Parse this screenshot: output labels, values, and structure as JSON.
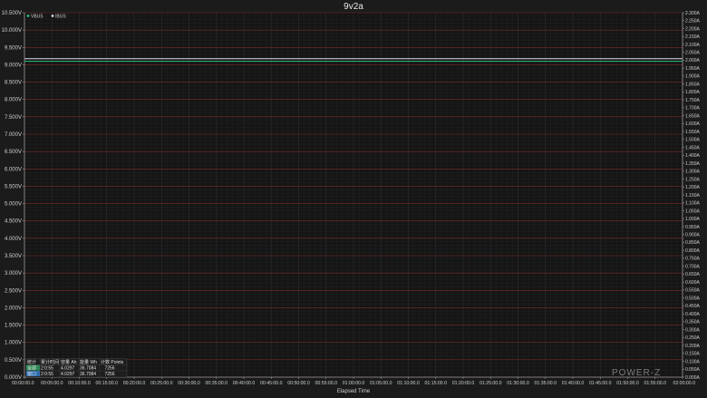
{
  "chart_data": {
    "type": "line",
    "title": "9v2a",
    "xlabel": "Elapsed Time",
    "ylabel_left": "",
    "ylabel_right": "",
    "x_ticks": [
      "00:00:00.0",
      "00:05:00.0",
      "00:10:00.0",
      "00:15:00.0",
      "00:20:00.0",
      "00:25:00.0",
      "00:30:00.0",
      "00:35:00.0",
      "00:40:00.0",
      "00:45:00.0",
      "00:50:00.0",
      "00:55:00.0",
      "01:00:00.0",
      "01:05:00.0",
      "01:10:00.0",
      "01:15:00.0",
      "01:20:00.0",
      "01:25:00.0",
      "01:30:00.0",
      "01:35:00.0",
      "01:40:00.0",
      "01:45:00.0",
      "01:50:00.0",
      "01:55:00.0",
      "02:00:00.0"
    ],
    "xlim_seconds": [
      0,
      7200
    ],
    "ylim_left": [
      0,
      10.5
    ],
    "y_left_ticks": [
      "0.000V",
      "0.500V",
      "1.000V",
      "1.500V",
      "2.000V",
      "2.500V",
      "3.000V",
      "3.500V",
      "4.000V",
      "4.500V",
      "5.000V",
      "5.500V",
      "6.000V",
      "6.500V",
      "7.000V",
      "7.500V",
      "8.000V",
      "8.500V",
      "9.000V",
      "9.500V",
      "10.000V",
      "10.500V"
    ],
    "ylim_right": [
      0,
      2.3
    ],
    "y_right_ticks": [
      "0.000A",
      "0.050A",
      "0.100A",
      "0.150A",
      "0.200A",
      "0.250A",
      "0.300A",
      "0.350A",
      "0.400A",
      "0.450A",
      "0.500A",
      "0.550A",
      "0.600A",
      "0.650A",
      "0.700A",
      "0.750A",
      "0.800A",
      "0.850A",
      "0.900A",
      "0.950A",
      "1.000A",
      "1.050A",
      "1.100A",
      "1.150A",
      "1.200A",
      "1.250A",
      "1.300A",
      "1.350A",
      "1.400A",
      "1.450A",
      "1.500A",
      "1.550A",
      "1.600A",
      "1.650A",
      "1.700A",
      "1.750A",
      "1.800A",
      "1.850A",
      "1.900A",
      "1.950A",
      "2.000A",
      "2.050A",
      "2.100A",
      "2.150A",
      "2.200A",
      "2.250A",
      "2.300A"
    ],
    "grid": true,
    "legend_position": "top-left",
    "series": [
      {
        "name": "VBUS",
        "axis": "left",
        "color": "#2ec27e",
        "x": [
          0,
          7200
        ],
        "y": [
          9.1,
          9.1
        ]
      },
      {
        "name": "IBUS",
        "axis": "right",
        "color": "#d9d9e6",
        "x": [
          0,
          7200
        ],
        "y": [
          2.01,
          2.01
        ]
      }
    ]
  },
  "stats": {
    "header": [
      "统计",
      "累计时间",
      "容量 Ah",
      "能量 Wh",
      "计数 Points"
    ],
    "rows": [
      {
        "label": "全部",
        "label_color": "#2e8b57",
        "values": [
          "2:0:55",
          "4.0297",
          "36.7084",
          "7256"
        ]
      },
      {
        "label": "窗口",
        "label_color": "#2f6fb5",
        "values": [
          "2:0:55",
          "4.0297",
          "36.7084",
          "7256"
        ]
      }
    ]
  },
  "logo": "POWER-Z",
  "colors": {
    "background": "#1b1b1b",
    "grid_major": "#7a2e2e",
    "grid_minor": "#333333"
  }
}
